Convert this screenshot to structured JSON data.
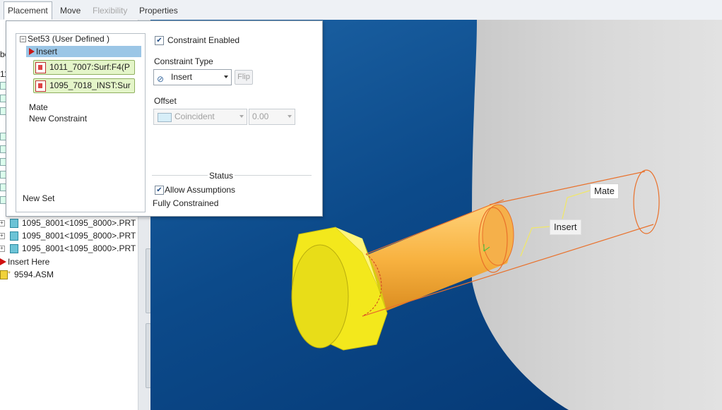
{
  "tabs": [
    {
      "label": "Placement",
      "active": true
    },
    {
      "label": "Move"
    },
    {
      "label": "Flexibility",
      "disabled": true
    },
    {
      "label": "Properties"
    }
  ],
  "tree": {
    "partial_left_chars": [
      "bc",
      "11"
    ],
    "rows": [
      "1095_8001<1095_8000>.PRT",
      "1095_8001<1095_8000>.PRT",
      "1095_8001<1095_8000>.PRT"
    ],
    "insert_here": "Insert Here",
    "asm": "9594.ASM"
  },
  "panel": {
    "set_name": "Set53 (User Defined )",
    "constraints": [
      {
        "label": "Insert",
        "selected": true
      },
      {
        "label": "Mate"
      },
      {
        "label": "New Constraint"
      }
    ],
    "references": [
      "1011_7007:Surf:F4(P",
      "1095_7018_INST:Sur"
    ],
    "new_set": "New Set",
    "constraint_enabled": "Constraint Enabled",
    "constraint_type_label": "Constraint Type",
    "constraint_type_value": "Insert",
    "flip": "Flip",
    "offset_label": "Offset",
    "offset_mode": "Coincident",
    "offset_value": "0.00",
    "status_label": "Status",
    "allow_assumptions": "Allow Assumptions",
    "status_text": "Fully Constrained"
  },
  "callouts": {
    "mate": "Mate",
    "insert": "Insert"
  },
  "colors": {
    "viewport_blue": "#0c4a8a",
    "bolt_head": "#f3e81c",
    "bolt_shank": "#f8b240",
    "highlight": "#e9702a",
    "selection": "#9bc6e6"
  }
}
